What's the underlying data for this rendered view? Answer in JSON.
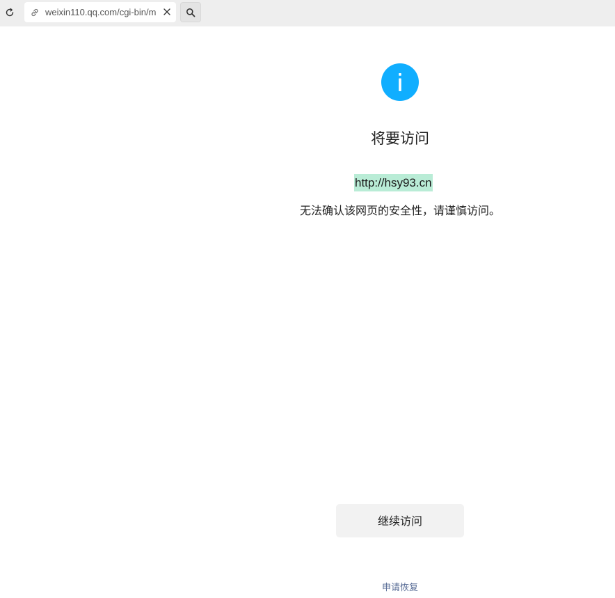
{
  "browser": {
    "address": "weixin110.qq.com/cgi-bin/m",
    "icons": {
      "reload": "reload-icon",
      "link": "link-icon",
      "clear": "close-icon",
      "search": "search-icon"
    }
  },
  "page": {
    "info_icon": "info-icon",
    "accent_color": "#10aeff",
    "title": "将要访问",
    "target_url": "http://hsy93.cn",
    "target_url_highlight": "#b9ecd6",
    "warning": "无法确认该网页的安全性，请谨慎访问。",
    "continue_label": "继续访问",
    "appeal_label": "申请恢复",
    "link_color": "#576b95"
  }
}
